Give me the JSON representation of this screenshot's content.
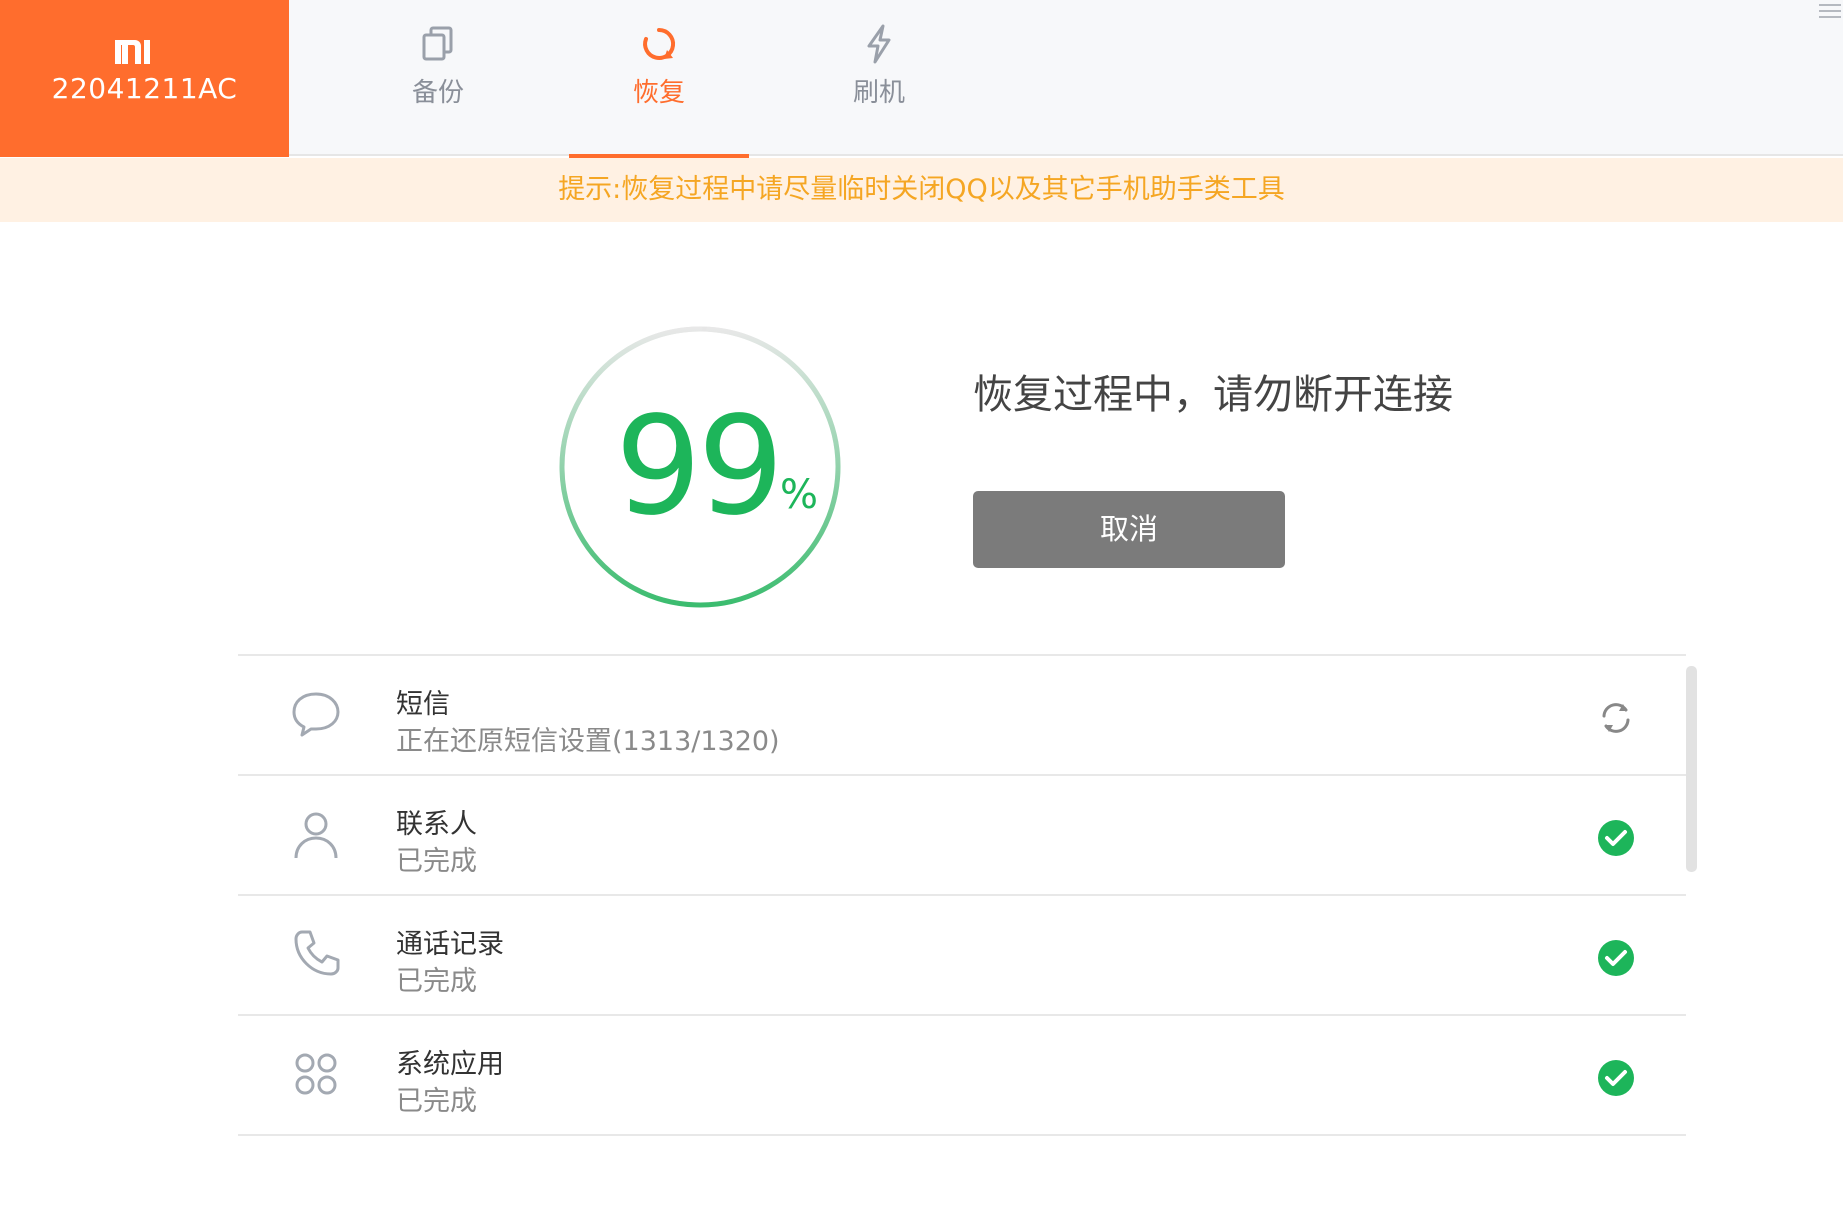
{
  "device": {
    "logo": "MI",
    "model": "22041211AC",
    "accent_color": "#ff6d2d"
  },
  "tabs": [
    {
      "label": "备份",
      "icon": "copy-icon",
      "active": false
    },
    {
      "label": "恢复",
      "icon": "restore-icon",
      "active": true
    },
    {
      "label": "刷机",
      "icon": "lightning-icon",
      "active": false
    }
  ],
  "notice": "提示:恢复过程中请尽量临时关闭QQ以及其它手机助手类工具",
  "progress": {
    "value": "99",
    "unit": "%",
    "fraction": 0.99,
    "color": "#1db55a"
  },
  "status_title": "恢复过程中，请勿断开连接",
  "cancel_label": "取消",
  "items": [
    {
      "title": "短信",
      "subtitle": "正在还原短信设置(1313/1320)",
      "icon": "message-icon",
      "state": "in-progress"
    },
    {
      "title": "联系人",
      "subtitle": "已完成",
      "icon": "person-icon",
      "state": "done"
    },
    {
      "title": "通话记录",
      "subtitle": "已完成",
      "icon": "phone-icon",
      "state": "done"
    },
    {
      "title": "系统应用",
      "subtitle": "已完成",
      "icon": "apps-icon",
      "state": "done"
    }
  ]
}
